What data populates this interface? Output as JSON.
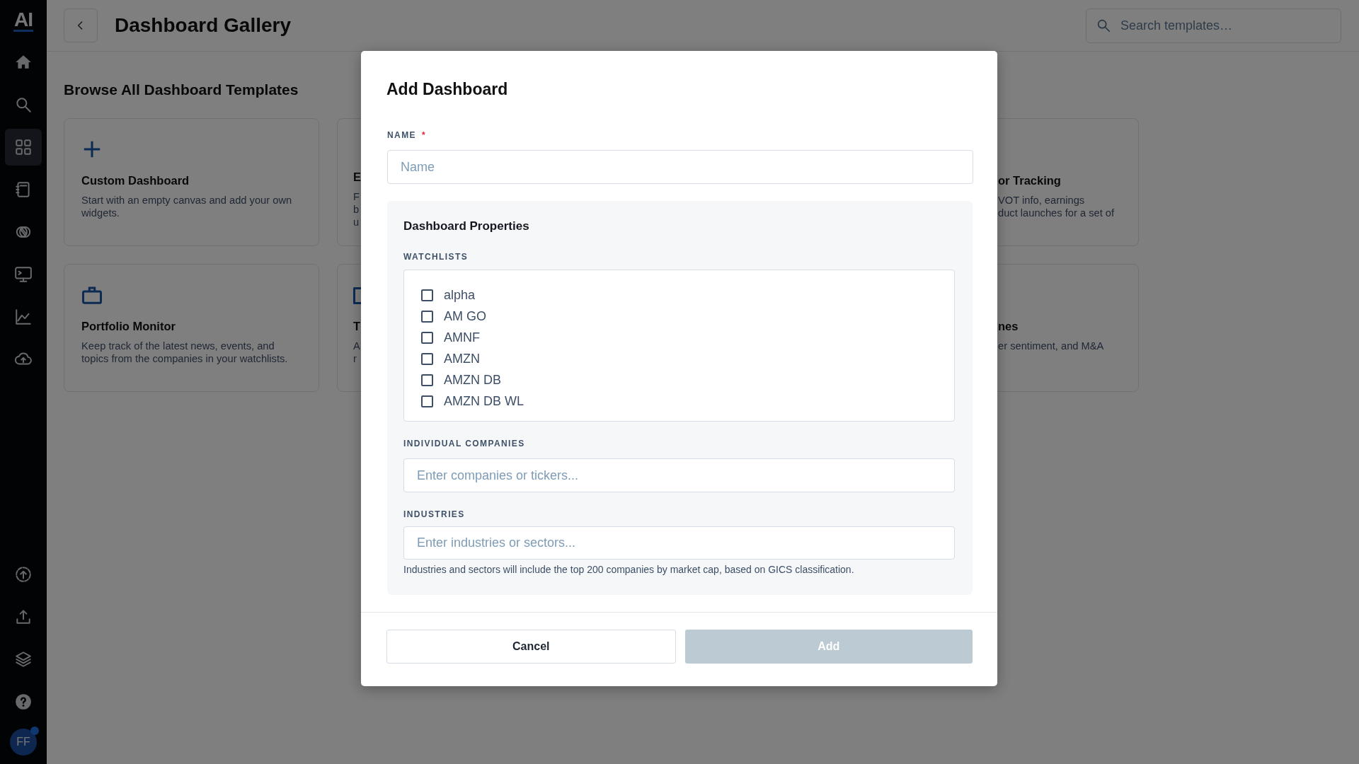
{
  "sidebar": {
    "logo": "AI",
    "items": [
      {
        "selected": false
      },
      {
        "selected": false
      },
      {
        "selected": true
      },
      {
        "selected": false
      },
      {
        "selected": false
      },
      {
        "selected": false
      },
      {
        "selected": false
      },
      {
        "selected": false
      }
    ],
    "bottom_items": [
      {
        "selected": false
      },
      {
        "selected": false
      },
      {
        "selected": false
      },
      {
        "selected": false
      }
    ],
    "avatar": {
      "initials": "FF",
      "notification": true
    }
  },
  "header": {
    "title": "Dashboard Gallery",
    "search": {
      "placeholder": "Search templates…"
    }
  },
  "section_title": "Browse All Dashboard Templates",
  "cards": [
    {
      "kind": "full",
      "title": "Custom Dashboard",
      "description": "Start with an empty canvas and add your own widgets."
    },
    {
      "kind": "cut_right",
      "title": "E",
      "lines": [
        "F",
        "b",
        "u"
      ],
      "icon_visible": false
    },
    {
      "kind": "cut_left",
      "title": "or Tracking",
      "lines": [
        "VOT info, earnings",
        "duct launches for a set of"
      ]
    },
    {
      "kind": "full",
      "title": "Portfolio Monitor",
      "description": "Keep track of the latest news, events, and topics from the companies in your watchlists."
    },
    {
      "kind": "cut_right",
      "title": "T",
      "lines": [
        "A",
        "r"
      ],
      "icon_visible": true
    },
    {
      "kind": "cut_left",
      "title": "nes",
      "lines": [
        "er sentiment, and M&A"
      ]
    }
  ],
  "modal": {
    "title": "Add Dashboard",
    "name_field": {
      "label": "NAME",
      "required_mark": "*",
      "placeholder": "Name"
    },
    "properties": {
      "title": "Dashboard Properties",
      "watchlists": {
        "label": "WATCHLISTS",
        "items": [
          {
            "label": "alpha",
            "checked": false
          },
          {
            "label": "AM GO",
            "checked": false
          },
          {
            "label": "AMNF",
            "checked": false
          },
          {
            "label": "AMZN",
            "checked": false
          },
          {
            "label": "AMZN DB",
            "checked": false
          },
          {
            "label": "AMZN DB WL",
            "checked": false
          }
        ]
      },
      "companies": {
        "label": "INDIVIDUAL COMPANIES",
        "placeholder": "Enter companies or tickers..."
      },
      "industries": {
        "label": "INDUSTRIES",
        "placeholder": "Enter industries or sectors...",
        "help": "Industries and sectors will include the top 200 companies by market cap, based on GICS classification."
      }
    },
    "buttons": [
      {
        "label": "Cancel",
        "kind": "secondary",
        "disabled": false
      },
      {
        "label": "Add",
        "kind": "primary",
        "disabled": true
      }
    ]
  }
}
